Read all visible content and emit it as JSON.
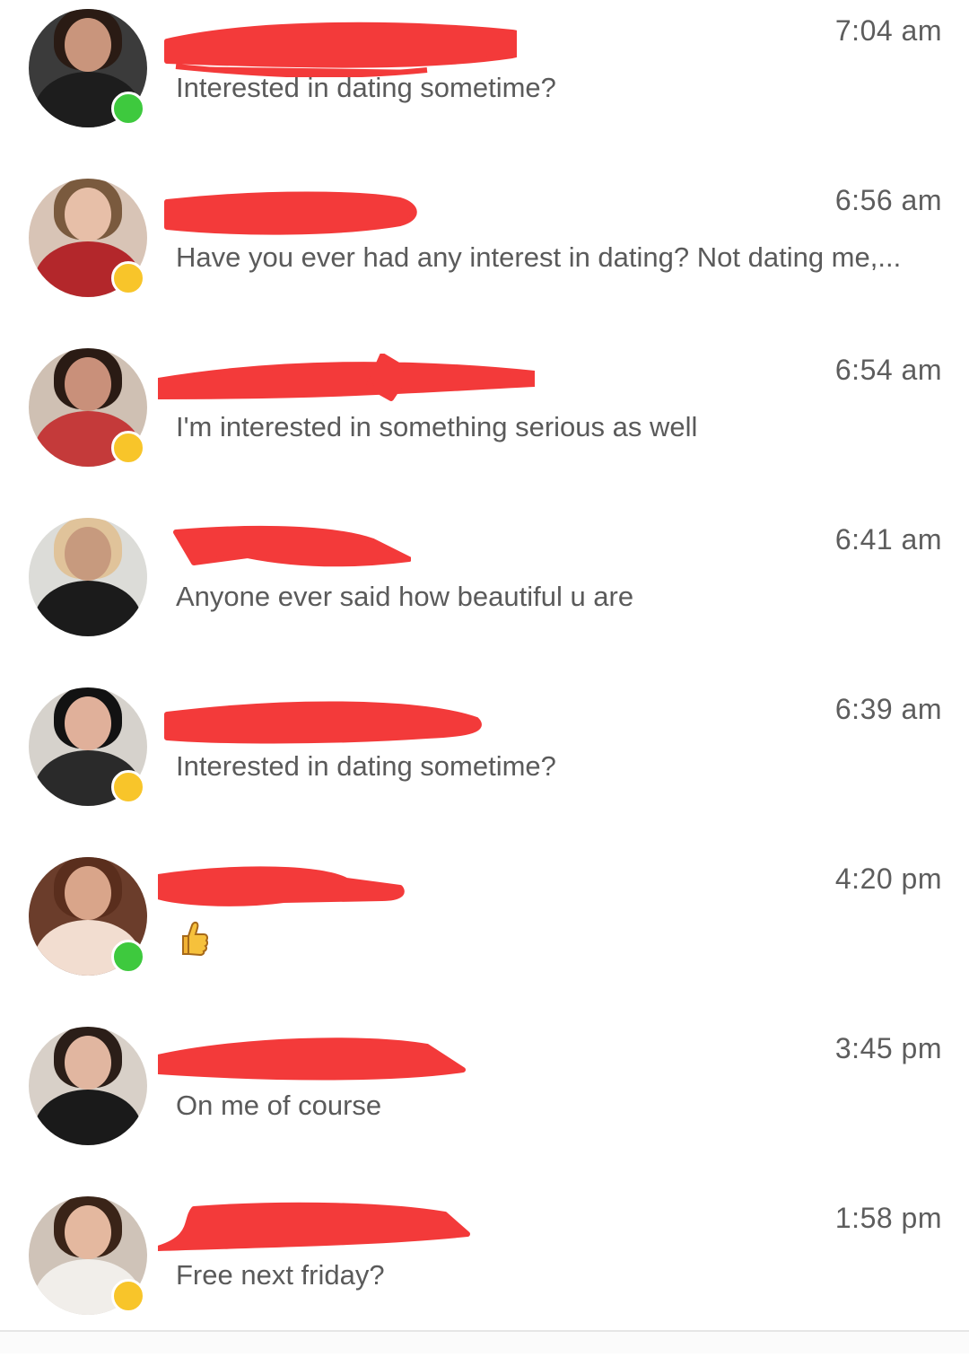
{
  "colors": {
    "online": "#3ec93e",
    "away": "#f8c52a",
    "redaction": "#f33a3a",
    "time_text": "#5d5d5d",
    "message_text": "#5a5a5a"
  },
  "conversations": [
    {
      "name": "",
      "time": "7:04 am",
      "message": "Interested in dating sometime?",
      "status": "online",
      "avatar": {
        "bg": "#3b3b3b",
        "skin": "#c9957c",
        "hair": "#2a1b14",
        "top": "#1d1d1d"
      }
    },
    {
      "name": "",
      "time": "6:56 am",
      "message": "Have you ever had any interest in dating? Not dating me,...",
      "status": "away",
      "avatar": {
        "bg": "#d8c4b6",
        "skin": "#e7bfa8",
        "hair": "#7a5a3e",
        "top": "#b3272b"
      }
    },
    {
      "name": "",
      "time": "6:54 am",
      "message": "I'm interested in something serious as well",
      "status": "away",
      "avatar": {
        "bg": "#cfc0b3",
        "skin": "#c9907a",
        "hair": "#2a1b14",
        "top": "#c43a3a"
      }
    },
    {
      "name": "",
      "time": "6:41 am",
      "message": "Anyone ever said how beautiful u are",
      "status": "none",
      "avatar": {
        "bg": "#dcdcd8",
        "skin": "#c79a7e",
        "hair": "#e0c39a",
        "top": "#1b1b1b"
      }
    },
    {
      "name": "",
      "time": "6:39 am",
      "message": "Interested in dating sometime?",
      "status": "away",
      "avatar": {
        "bg": "#d6d2cc",
        "skin": "#e0b09a",
        "hair": "#121212",
        "top": "#2a2a2a"
      }
    },
    {
      "name": "",
      "time": "4:20 pm",
      "message": "👍",
      "status": "online",
      "avatar": {
        "bg": "#6b3d2b",
        "skin": "#d9a58a",
        "hair": "#5a2e1d",
        "top": "#f2ddd0"
      }
    },
    {
      "name": "",
      "time": "3:45 pm",
      "message": "On me of course",
      "status": "none",
      "avatar": {
        "bg": "#d8d0c8",
        "skin": "#e1b6a0",
        "hair": "#2b1e18",
        "top": "#1a1a1a"
      }
    },
    {
      "name": "",
      "time": "1:58 pm",
      "message": "Free next friday?",
      "status": "away",
      "avatar": {
        "bg": "#cfc3b8",
        "skin": "#e4b89f",
        "hair": "#3a2418",
        "top": "#f1eeea"
      }
    }
  ]
}
